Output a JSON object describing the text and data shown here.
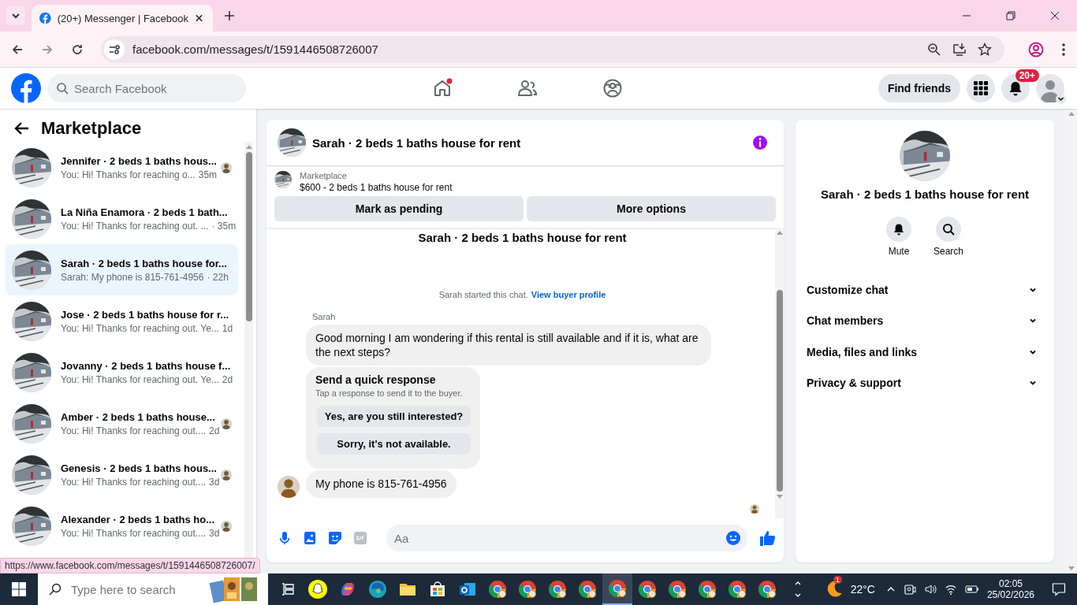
{
  "browser": {
    "tab_title": "(20+) Messenger | Facebook",
    "url": "facebook.com/messages/t/1591446508726007",
    "status_link": "https://www.facebook.com/messages/t/1591446508726007/"
  },
  "header": {
    "search": {
      "placeholder": "Search Facebook"
    },
    "nav": [
      {
        "kind": "home",
        "unread": true
      },
      {
        "kind": "friends",
        "unread": false
      },
      {
        "kind": "groups",
        "unread": false
      }
    ],
    "find_friends": "Find friends",
    "notifications_badge": "20+"
  },
  "sidebar": {
    "title": "Marketplace",
    "conversations": [
      {
        "title": "Jennifer · 2 beds 1 baths hous...",
        "preview": "You: Hi! Thanks for reaching o...",
        "time": "35m",
        "selected": false,
        "seen": true
      },
      {
        "title": "La Niña Enamora · 2 beds 1 bath...",
        "preview": "You: Hi! Thanks for reaching out. ...",
        "time": "· 35m",
        "selected": false,
        "seen": false
      },
      {
        "title": "Sarah · 2 beds 1 baths house for...",
        "preview": "Sarah: My phone is 815-761-4956",
        "time": "· 22h",
        "selected": true,
        "seen": false
      },
      {
        "title": "Jose · 2 beds 1 baths house for r...",
        "preview": "You: Hi! Thanks for reaching out. Ye...",
        "time": "1d",
        "selected": false,
        "seen": false
      },
      {
        "title": "Jovanny · 2 beds 1 baths house f...",
        "preview": "You: Hi! Thanks for reaching out. Ye...",
        "time": "2d",
        "selected": false,
        "seen": false
      },
      {
        "title": "Amber · 2 beds 1 baths house...",
        "preview": "You: Hi! Thanks for reaching out....",
        "time": "2d",
        "selected": false,
        "seen": true
      },
      {
        "title": "Genesis · 2 beds 1 baths hous...",
        "preview": "You: Hi! Thanks for reaching out....",
        "time": "3d",
        "selected": false,
        "seen": true
      },
      {
        "title": "Alexander · 2 beds 1 baths ho...",
        "preview": "You: Hi! Thanks for reaching out....",
        "time": "3d",
        "selected": false,
        "seen": true
      }
    ]
  },
  "chat": {
    "title": "Sarah · 2 beds 1 baths house for rent",
    "listing": {
      "label": "Marketplace",
      "title": "$600 - 2 beds 1 baths house for rent"
    },
    "actions": [
      "Mark as pending",
      "More options"
    ],
    "heading": "Sarah · 2 beds 1 baths house for rent",
    "started": "Sarah started this chat.",
    "profile_link": "View buyer profile",
    "sender": "Sarah",
    "messages": [
      {
        "kind": "text",
        "text": "Good morning I am wondering if this rental is still available and if it is, what are the next steps?",
        "avatar": false
      },
      {
        "kind": "quick_response",
        "title": "Send a quick response",
        "hint": "Tap a response to send it to the buyer.",
        "options": [
          "Yes, are you still interested?",
          "Sorry, it's not available."
        ]
      },
      {
        "kind": "text",
        "text": "My phone is 815-761-4956",
        "avatar": true
      }
    ],
    "composer": {
      "placeholder": "Aa"
    }
  },
  "details": {
    "name": "Sarah · 2 beds 1 baths house for rent",
    "actions": [
      {
        "kind": "mute",
        "label": "Mute"
      },
      {
        "kind": "search",
        "label": "Search"
      }
    ],
    "sections": [
      {
        "label": "Customize chat",
        "expanded": false
      },
      {
        "label": "Chat members",
        "expanded": false
      },
      {
        "label": "Media, files and links",
        "expanded": false
      },
      {
        "label": "Privacy & support",
        "expanded": false
      }
    ]
  },
  "taskbar": {
    "search": {
      "placeholder": "Type here to search"
    },
    "apps": [
      {
        "kind": "taskview",
        "selected": false
      },
      {
        "kind": "snapchat",
        "selected": false
      },
      {
        "kind": "copilot",
        "selected": false
      },
      {
        "kind": "edge",
        "selected": false
      },
      {
        "kind": "files",
        "selected": false
      },
      {
        "kind": "store",
        "selected": false
      },
      {
        "kind": "outlook",
        "selected": false
      },
      {
        "kind": "chrome",
        "selected": false
      },
      {
        "kind": "chrome",
        "selected": false
      },
      {
        "kind": "chrome",
        "selected": false
      },
      {
        "kind": "chrome",
        "selected": false
      },
      {
        "kind": "chrome",
        "selected": true
      },
      {
        "kind": "chrome",
        "selected": false
      },
      {
        "kind": "chrome",
        "selected": false
      },
      {
        "kind": "chrome",
        "selected": false
      },
      {
        "kind": "chrome",
        "selected": false
      },
      {
        "kind": "chrome",
        "selected": false
      }
    ],
    "weather_badge": "1",
    "temperature": "22°C",
    "time": "02:05",
    "date": "25/02/2026"
  }
}
